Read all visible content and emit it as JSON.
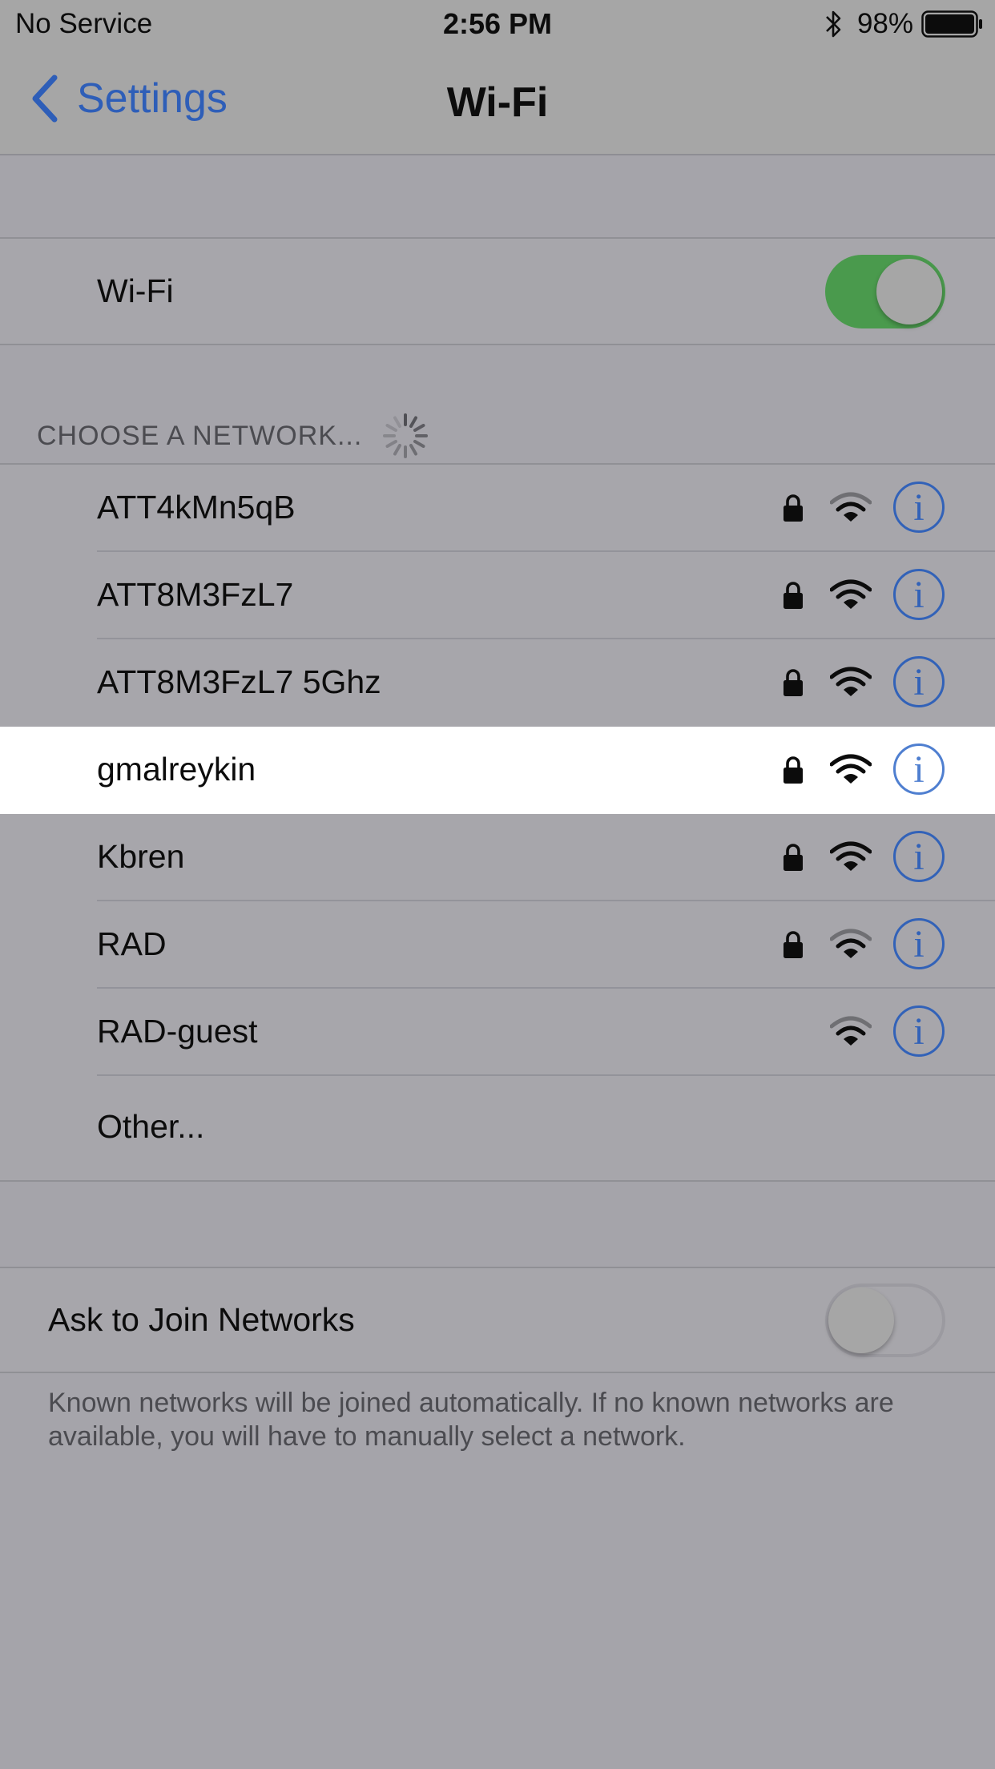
{
  "status_bar": {
    "carrier": "No Service",
    "time": "2:56 PM",
    "battery_percent": "98%",
    "bluetooth_icon": "bluetooth-icon",
    "battery_icon": "battery-icon"
  },
  "nav": {
    "back_label": "Settings",
    "title": "Wi-Fi"
  },
  "wifi_toggle": {
    "label": "Wi-Fi",
    "on": true
  },
  "networks_section": {
    "header": "CHOOSE A NETWORK...",
    "networks": [
      {
        "name": "ATT4kMn5qB",
        "secured": true,
        "signal": 2,
        "selected": false
      },
      {
        "name": "ATT8M3FzL7",
        "secured": true,
        "signal": 3,
        "selected": false
      },
      {
        "name": "ATT8M3FzL7 5Ghz",
        "secured": true,
        "signal": 3,
        "selected": false
      },
      {
        "name": "gmalreykin",
        "secured": true,
        "signal": 3,
        "selected": true
      },
      {
        "name": "Kbren",
        "secured": true,
        "signal": 3,
        "selected": false
      },
      {
        "name": "RAD",
        "secured": true,
        "signal": 2,
        "selected": false
      },
      {
        "name": "RAD-guest",
        "secured": false,
        "signal": 2,
        "selected": false
      }
    ],
    "info_label": "i",
    "other_label": "Other..."
  },
  "ask_to_join": {
    "label": "Ask to Join Networks",
    "on": false,
    "footer": "Known networks will be joined automatically. If no known networks are available, you will have to manually select a network."
  },
  "colors": {
    "accent_blue": "#2e5eb8",
    "toggle_green": "#4a9a4d",
    "selected_row": "#ffffff"
  }
}
